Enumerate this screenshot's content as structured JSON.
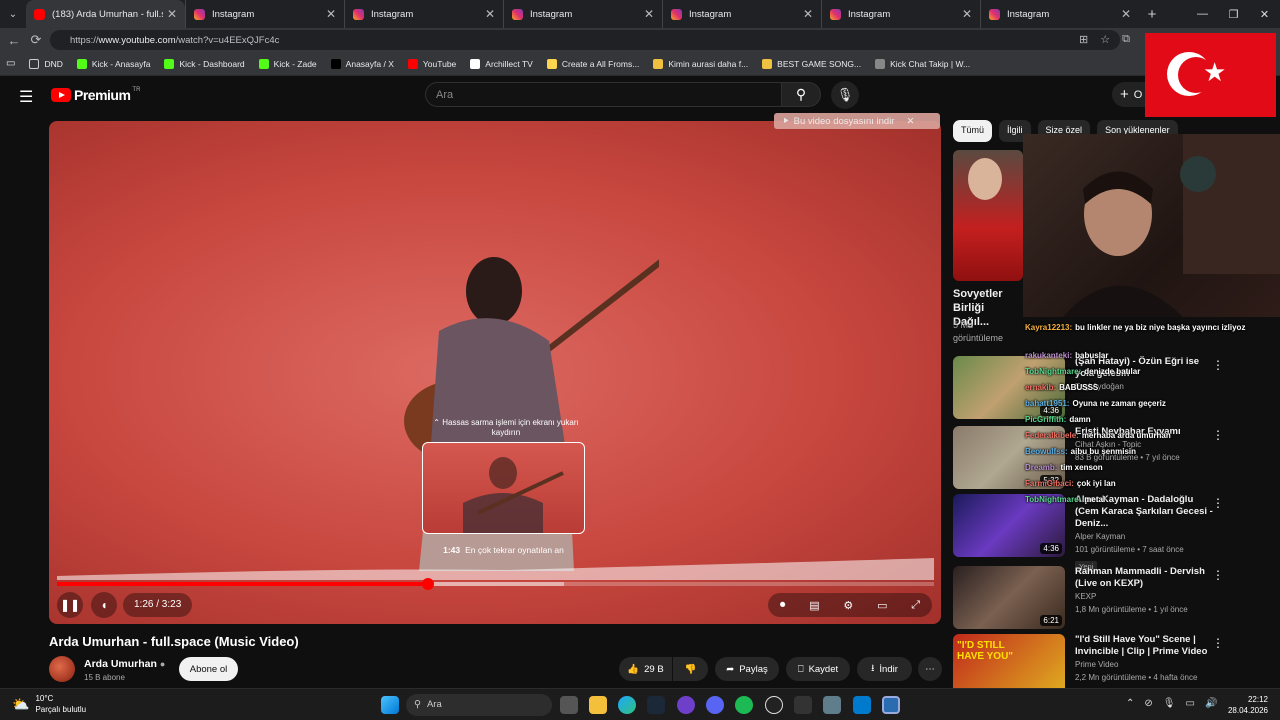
{
  "browser": {
    "tabs": [
      {
        "title": "(183) Arda Umurhan - full.spa",
        "icon": "youtube-icon",
        "active": true
      },
      {
        "title": "Instagram",
        "icon": "instagram-icon"
      },
      {
        "title": "Instagram",
        "icon": "instagram-icon"
      },
      {
        "title": "Instagram",
        "icon": "instagram-icon"
      },
      {
        "title": "Instagram",
        "icon": "instagram-icon"
      },
      {
        "title": "Instagram",
        "icon": "instagram-icon"
      },
      {
        "title": "Instagram",
        "icon": "instagram-icon"
      }
    ],
    "url_prefix": "https://",
    "url_host": "www.youtube.com",
    "url_path": "/watch?v=u4EExQJFc4c",
    "bookmarks": [
      {
        "label": "DND",
        "icon": "folder-icon"
      },
      {
        "label": "Kick - Anasayfa",
        "icon": "kick-icon"
      },
      {
        "label": "Kick - Dashboard",
        "icon": "kick-icon"
      },
      {
        "label": "Kick - Zade",
        "icon": "kick-icon"
      },
      {
        "label": "Anasayfa / X",
        "icon": "x-icon"
      },
      {
        "label": "YouTube",
        "icon": "youtube-icon"
      },
      {
        "label": "Archillect TV",
        "icon": "archillect-icon"
      },
      {
        "label": "Create a All Froms...",
        "icon": "forms-icon"
      },
      {
        "label": "Kimin aurasi daha f...",
        "icon": "bookmark-icon"
      },
      {
        "label": "BEST GAME SONG...",
        "icon": "bookmark-icon"
      },
      {
        "label": "Kick Chat Takip | W...",
        "icon": "globe-icon"
      }
    ]
  },
  "youtube": {
    "logo_text": "Premium",
    "logo_region": "TR",
    "search_placeholder": "Ara",
    "create_label": "O",
    "download_bar": "Bu video dosyasını indir",
    "seek_hint": "Hassas sarma işlemi için ekranı yukarı kaydırın",
    "preview_time": "1:43",
    "preview_label": "En çok tekrar oynatılan an",
    "time_display": "1:26 / 3:23",
    "progress_fraction": 0.423,
    "buffer_fraction": 0.578,
    "video_title": "Arda Umurhan - full.space (Music Video)",
    "channel_name": "Arda Umurhan",
    "subscribers": "15 B abone",
    "subscribe_label": "Abone ol",
    "likes": "29 B",
    "share_label": "Paylaş",
    "save_label": "Kaydet",
    "download_label": "İndir",
    "chips": [
      "Tümü",
      "İlgili",
      "Size özel",
      "Son yüklenenler"
    ],
    "sovyet_title": "Sovyetler Birliği Dağıl...",
    "sovyet_views": "5 Mn",
    "sovyet_views2": "görüntüleme",
    "recs": [
      {
        "title": "(Şah Hatayi) - Özün Eğri ise yola gelesin",
        "channel": "Ezgi Aydoğan",
        "meta": "",
        "duration": "4:36"
      },
      {
        "title": "Eristi Nevbahar Eyvamı",
        "channel": "Cihat Aşkın - Topic",
        "meta": "83 B görüntüleme • 7 yıl önce",
        "duration": "5:32"
      },
      {
        "title": "Alper Kayman - Dadaloğlu (Cem Karaca Şarkıları Gecesi - Deniz...",
        "channel": "Alper Kayman",
        "meta": "101 görüntüleme • 7 saat önce",
        "badge": "Yeni",
        "duration": "4:36"
      },
      {
        "title": "Rahman Mammadli - Dervish (Live on KEXP)",
        "channel": "KEXP",
        "meta": "1,8 Mn görüntüleme • 1 yıl önce",
        "duration": "6:21"
      },
      {
        "title": "\"I'd Still Have You\" Scene | Invincible | Clip | Prime Video",
        "channel": "Prime Video",
        "meta": "2,2 Mn görüntüleme • 4 hafta önce",
        "duration": ""
      }
    ],
    "thumb5_text": "\"I'D STILL HAVE YOU\""
  },
  "chat": [
    {
      "user": "Kayra12213:",
      "msg": "bu linkler ne ya biz niye başka yayıncı izliyoz",
      "color": "#f5b041"
    },
    {
      "user": "rakukanteki:",
      "msg": "babuslar",
      "color": "#bb8fce"
    },
    {
      "user": "TobNightmare:",
      "msg": "denizde batılar",
      "color": "#58d68d"
    },
    {
      "user": "ernakib:",
      "msg": "BABUSSS",
      "color": "#ec7063"
    },
    {
      "user": "bahatt1951:",
      "msg": "Oyuna ne zaman geçeriz",
      "color": "#5dade2"
    },
    {
      "user": "PicGriffith:",
      "msg": "damn",
      "color": "#58d68d"
    },
    {
      "user": "Federalkibele:",
      "msg": "merhaba arda umurhan",
      "color": "#ec7063"
    },
    {
      "user": "Beowulfss:",
      "msg": "aibu bu şenmisin",
      "color": "#5dade2"
    },
    {
      "user": "Dreamb:",
      "msg": "tim xenson",
      "color": "#bb8fce"
    },
    {
      "user": "FarmiGibaci:",
      "msg": "çok iyi lan",
      "color": "#ec7063"
    },
    {
      "user": "TobNightmare:",
      "msg": "metal",
      "color": "#58d68d"
    }
  ],
  "taskbar": {
    "temp": "10°C",
    "weather": "Parçalı bulutlu",
    "search": "Ara",
    "time": "22:12",
    "date": "28.04.2026"
  },
  "colors": {
    "accent": "#ff0000",
    "bg": "#0f0f0f",
    "flag_red": "#e30a17"
  }
}
